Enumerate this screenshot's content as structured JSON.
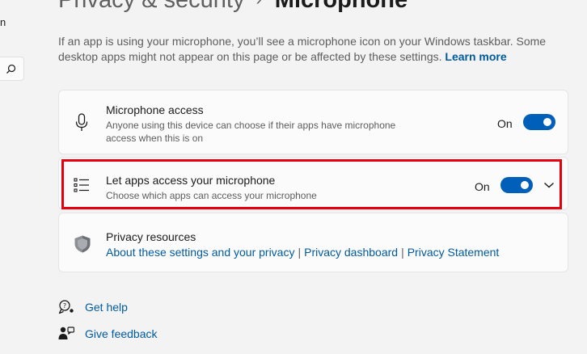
{
  "sidebar": {
    "partial_text": "n",
    "search_icon": "search-icon"
  },
  "header": {
    "crumb": "Privacy & security",
    "separator": "›",
    "title": "Microphone"
  },
  "description": {
    "text": "If an app is using your microphone, you’ll see a microphone icon on your Windows taskbar. Some desktop apps might not appear on this page or be affected by these settings.",
    "link": "Learn more"
  },
  "cards": {
    "microphone_access": {
      "icon": "microphone-icon",
      "title": "Microphone access",
      "subtitle": "Anyone using this device can choose if their apps have microphone access when this is on",
      "state_label": "On",
      "enabled": true
    },
    "apps_access": {
      "icon": "app-list-icon",
      "title": "Let apps access your microphone",
      "subtitle": "Choose which apps can access your microphone",
      "state_label": "On",
      "enabled": true,
      "expand_icon": "chevron-down-icon"
    },
    "privacy_resources": {
      "icon": "shield-icon",
      "title": "Privacy resources",
      "links": [
        "About these settings and your privacy",
        "Privacy dashboard",
        "Privacy Statement"
      ],
      "separator": "|"
    }
  },
  "help": {
    "get_help": "Get help",
    "give_feedback": "Give feedback"
  },
  "colors": {
    "accent": "#005fb8",
    "link": "#005a9e",
    "highlight": "#e6000f"
  }
}
